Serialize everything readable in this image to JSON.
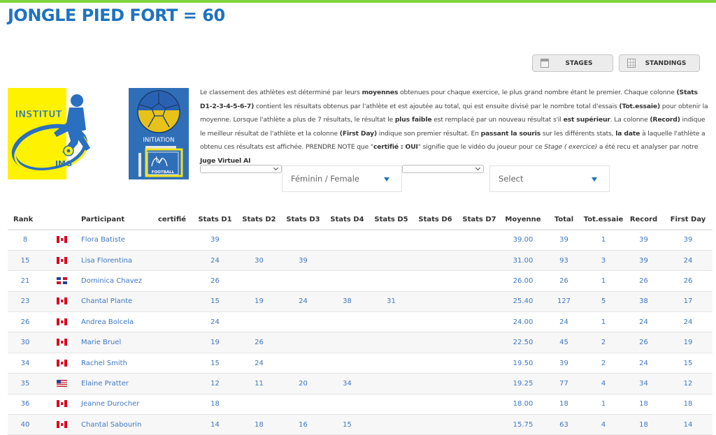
{
  "colors": {
    "accent_bar": "#7ed43f",
    "title": "#1e73be",
    "link": "#3f77c2",
    "caret": "#1e73be"
  },
  "page": {
    "title": "JONGLE PIED FORT = 60"
  },
  "toolbar": {
    "stages_label": "STAGES",
    "stages_icon": "calendar-icon",
    "standings_label": "STANDINGS",
    "standings_icon": "grid-icon"
  },
  "logos": {
    "institut": {
      "line1": "INSTITUT",
      "line2": "JMG"
    },
    "initiation": {
      "line1": "INITIATION",
      "line2": "FOOTBALL",
      "monogram": "JMG"
    }
  },
  "description": {
    "p1": "Le classement des athlètes est déterminé par leurs ",
    "b1": "moyennes",
    "p2": " obtenues pour chaque exercice, le plus grand nombre étant le premier. Chaque colonne ",
    "b2": "(Stats D1-2-3-4-5-6-7)",
    "p3": " contient les résultats obtenus par l'athlète et est ajoutée au total, qui est ensuite divisé par le nombre total d'essais ",
    "b3": "(Tot.essaie)",
    "p4": " pour obtenir la moyenne. Lorsque l'athlète a plus de 7 résultats, le résultat le ",
    "b4": "plus faible",
    "p5": " est remplacé par un nouveau résultat s'il ",
    "b5": "est supérieur",
    "p6": ". La colonne ",
    "b6": "(Record)",
    "p7": " indique le meilleur résultat de l'athlète et la colonne ",
    "b7": "(First Day)",
    "p8": " indique son premier résultat. En ",
    "b8": "passant la souris",
    "p9": " sur les différents stats, ",
    "b9": "la date",
    "p10": " à laquelle l'athlète a obtenu ces résultats est affichée. PRENDRE NOTE que \"",
    "b10": "certifié : OUI",
    "p11": "\" signifie que le vidéo du joueur pour ce ",
    "i1": "Stage ( exercice)",
    "p12": " a été recu et analyser par notre ",
    "b11": "Juge Virtuel AI"
  },
  "filters": {
    "select1_value": "",
    "gender_value": "Féminin / Female",
    "select2_value": "",
    "category_value": "Select"
  },
  "table": {
    "headers": [
      "Rank",
      "",
      "Participant",
      "certifié",
      "Stats D1",
      "Stats D2",
      "Stats D3",
      "Stats D4",
      "Stats D5",
      "Stats D6",
      "Stats D7",
      "Moyenne",
      "Total",
      "Tot.essaie",
      "Record",
      "First Day"
    ],
    "rows": [
      {
        "rank": "8",
        "flag": "ca",
        "name": "Flora Batiste",
        "certifie": "",
        "d1": "39",
        "d2": "",
        "d3": "",
        "d4": "",
        "d5": "",
        "d6": "",
        "d7": "",
        "moyenne": "39.00",
        "total": "39",
        "essais": "1",
        "record": "39",
        "first": "39"
      },
      {
        "rank": "15",
        "flag": "ca",
        "name": "Lisa Florentina",
        "certifie": "",
        "d1": "24",
        "d2": "30",
        "d3": "39",
        "d4": "",
        "d5": "",
        "d6": "",
        "d7": "",
        "moyenne": "31.00",
        "total": "93",
        "essais": "3",
        "record": "39",
        "first": "24"
      },
      {
        "rank": "21",
        "flag": "do",
        "name": "Dominica Chavez",
        "certifie": "",
        "d1": "26",
        "d2": "",
        "d3": "",
        "d4": "",
        "d5": "",
        "d6": "",
        "d7": "",
        "moyenne": "26.00",
        "total": "26",
        "essais": "1",
        "record": "26",
        "first": "26"
      },
      {
        "rank": "23",
        "flag": "ca",
        "name": "Chantal Plante",
        "certifie": "",
        "d1": "15",
        "d2": "19",
        "d3": "24",
        "d4": "38",
        "d5": "31",
        "d6": "",
        "d7": "",
        "moyenne": "25.40",
        "total": "127",
        "essais": "5",
        "record": "38",
        "first": "17"
      },
      {
        "rank": "26",
        "flag": "ca",
        "name": "Andrea Bolcela",
        "certifie": "",
        "d1": "24",
        "d2": "",
        "d3": "",
        "d4": "",
        "d5": "",
        "d6": "",
        "d7": "",
        "moyenne": "24.00",
        "total": "24",
        "essais": "1",
        "record": "24",
        "first": "24"
      },
      {
        "rank": "30",
        "flag": "ca",
        "name": "Marie Bruel",
        "certifie": "",
        "d1": "19",
        "d2": "26",
        "d3": "",
        "d4": "",
        "d5": "",
        "d6": "",
        "d7": "",
        "moyenne": "22.50",
        "total": "45",
        "essais": "2",
        "record": "26",
        "first": "19"
      },
      {
        "rank": "34",
        "flag": "ca",
        "name": "Rachel Smith",
        "certifie": "",
        "d1": "15",
        "d2": "24",
        "d3": "",
        "d4": "",
        "d5": "",
        "d6": "",
        "d7": "",
        "moyenne": "19.50",
        "total": "39",
        "essais": "2",
        "record": "24",
        "first": "15"
      },
      {
        "rank": "35",
        "flag": "us",
        "name": "Elaine Pratter",
        "certifie": "",
        "d1": "12",
        "d2": "11",
        "d3": "20",
        "d4": "34",
        "d5": "",
        "d6": "",
        "d7": "",
        "moyenne": "19.25",
        "total": "77",
        "essais": "4",
        "record": "34",
        "first": "12"
      },
      {
        "rank": "36",
        "flag": "ca",
        "name": "Jeanne Durocher",
        "certifie": "",
        "d1": "18",
        "d2": "",
        "d3": "",
        "d4": "",
        "d5": "",
        "d6": "",
        "d7": "",
        "moyenne": "18.00",
        "total": "18",
        "essais": "1",
        "record": "18",
        "first": "18"
      },
      {
        "rank": "40",
        "flag": "ca",
        "name": "Chantal Sabourin",
        "certifie": "",
        "d1": "14",
        "d2": "18",
        "d3": "16",
        "d4": "15",
        "d5": "",
        "d6": "",
        "d7": "",
        "moyenne": "15.75",
        "total": "63",
        "essais": "4",
        "record": "18",
        "first": "14"
      }
    ]
  }
}
